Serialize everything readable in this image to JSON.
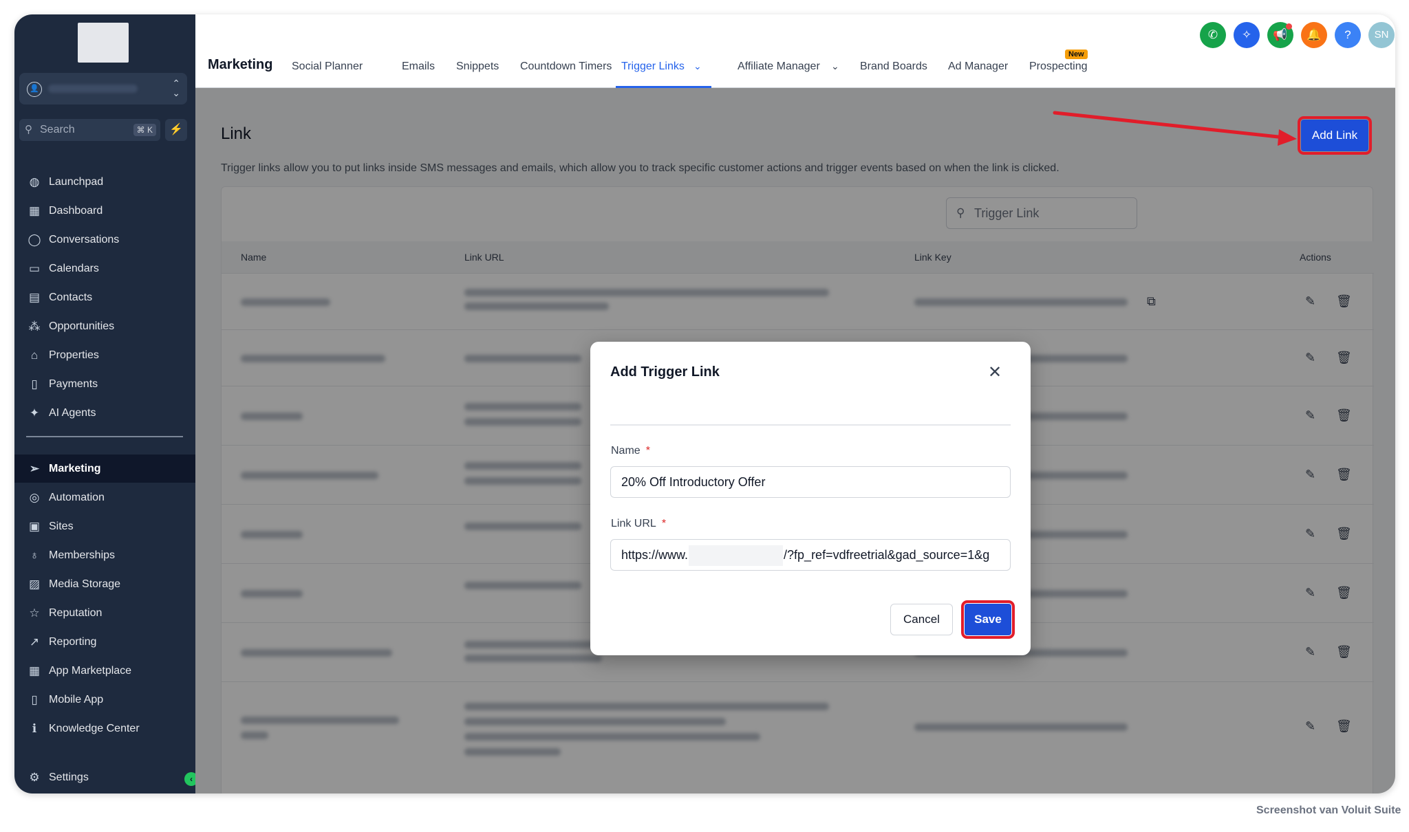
{
  "sidebar": {
    "search_placeholder": "Search",
    "search_shortcut": "⌘ K",
    "items": [
      {
        "label": "Launchpad",
        "icon": "rocket-icon"
      },
      {
        "label": "Dashboard",
        "icon": "dashboard-icon"
      },
      {
        "label": "Conversations",
        "icon": "chat-icon"
      },
      {
        "label": "Calendars",
        "icon": "calendar-icon"
      },
      {
        "label": "Contacts",
        "icon": "contacts-icon"
      },
      {
        "label": "Opportunities",
        "icon": "opportunities-icon"
      },
      {
        "label": "Properties",
        "icon": "home-icon"
      },
      {
        "label": "Payments",
        "icon": "receipt-icon"
      },
      {
        "label": "AI Agents",
        "icon": "sparkle-icon"
      },
      {
        "label": "Marketing",
        "icon": "send-icon"
      },
      {
        "label": "Automation",
        "icon": "automation-icon"
      },
      {
        "label": "Sites",
        "icon": "sites-icon"
      },
      {
        "label": "Memberships",
        "icon": "award-icon"
      },
      {
        "label": "Media Storage",
        "icon": "image-icon"
      },
      {
        "label": "Reputation",
        "icon": "star-icon"
      },
      {
        "label": "Reporting",
        "icon": "trend-icon"
      },
      {
        "label": "App Marketplace",
        "icon": "grid-icon"
      },
      {
        "label": "Mobile App",
        "icon": "mobile-icon"
      },
      {
        "label": "Knowledge Center",
        "icon": "info-icon"
      }
    ],
    "settings_label": "Settings"
  },
  "topbar": {
    "title": "Marketing",
    "tabs": [
      "Social Planner",
      "Emails",
      "Snippets",
      "Countdown Timers",
      "Trigger Links",
      "Affiliate Manager",
      "Brand Boards",
      "Ad Manager",
      "Prospecting"
    ],
    "new_badge": "New",
    "avatar_initials": "SN",
    "help_glyph": "?"
  },
  "page": {
    "title": "Link",
    "description": "Trigger links allow you to put links inside SMS messages and emails, which allow you to track specific customer actions and trigger events based on when the link is clicked.",
    "add_button": "Add Link",
    "search_placeholder": "Trigger Link",
    "columns": [
      "Name",
      "Link URL",
      "Link Key",
      "Actions"
    ]
  },
  "modal": {
    "title": "Add Trigger Link",
    "name_label": "Name",
    "name_value": "20% Off Introductory Offer",
    "url_label": "Link URL",
    "url_prefix": "https://www.",
    "url_suffix": "/?fp_ref=vdfreetrial&gad_source=1&g",
    "required_mark": "*",
    "cancel_label": "Cancel",
    "save_label": "Save"
  },
  "watermark": "Screenshot van Voluit Suite",
  "colors": {
    "sidebar_bg": "#1e2a3e",
    "primary": "#1d4ed8",
    "highlight": "#e11d2a",
    "active_tab": "#2563eb"
  }
}
